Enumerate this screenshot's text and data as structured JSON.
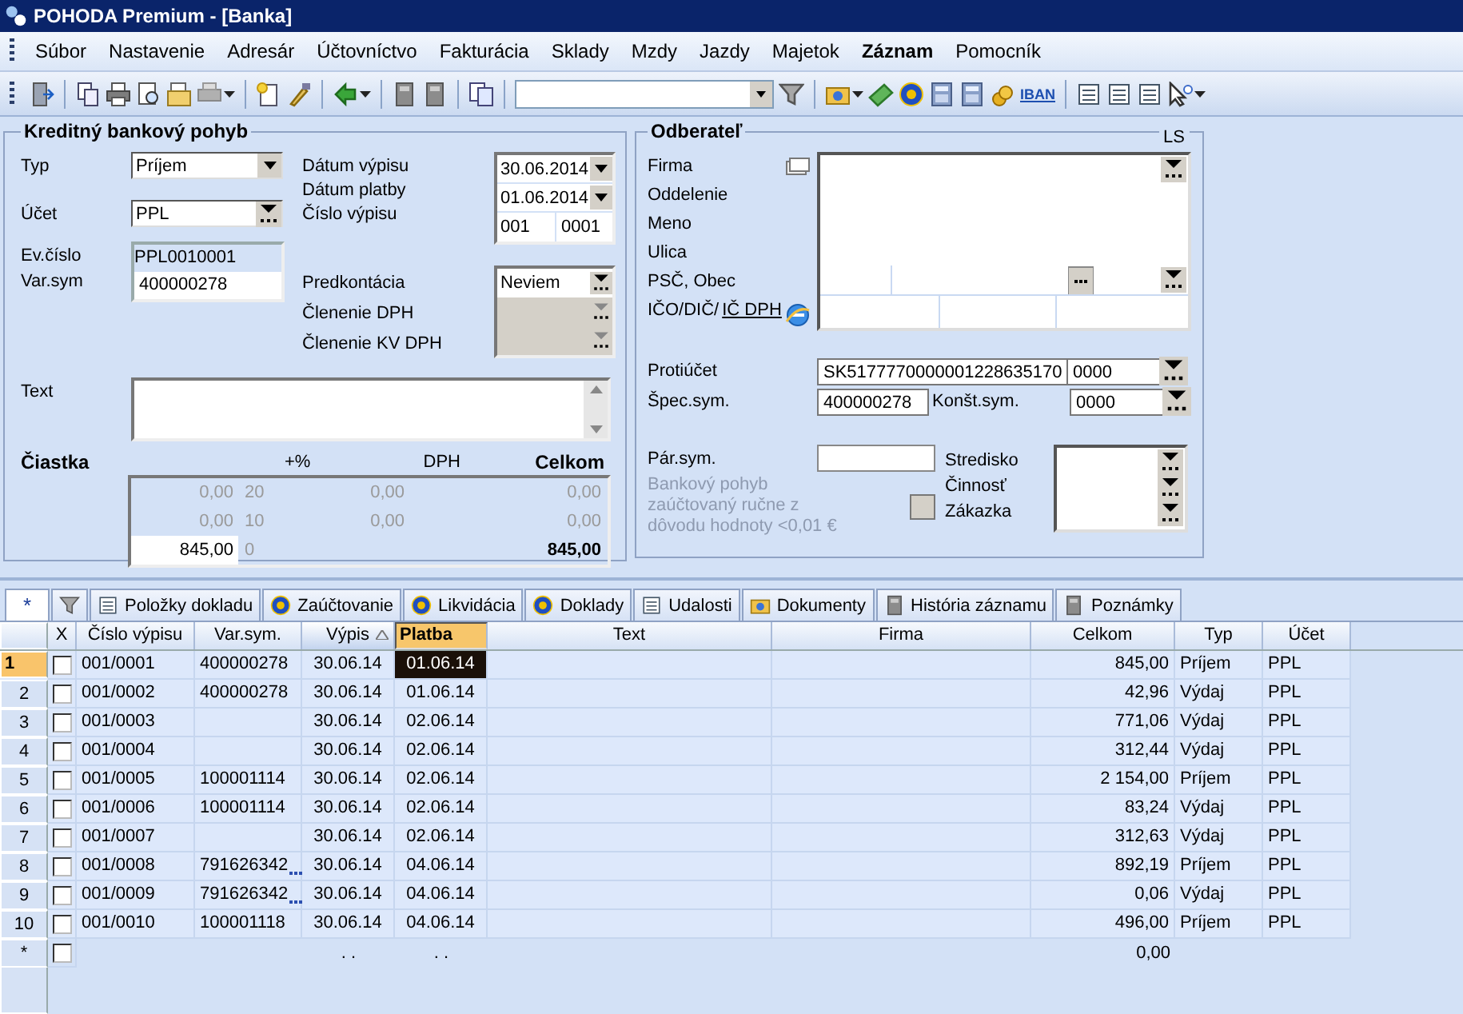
{
  "window": {
    "title": "POHODA Premium - [Banka]"
  },
  "menu": [
    {
      "label": "Súbor",
      "emphasized": false
    },
    {
      "label": "Nastavenie",
      "emphasized": false
    },
    {
      "label": "Adresár",
      "emphasized": false
    },
    {
      "label": "Účtovníctvo",
      "emphasized": false
    },
    {
      "label": "Fakturácia",
      "emphasized": false
    },
    {
      "label": "Sklady",
      "emphasized": false
    },
    {
      "label": "Mzdy",
      "emphasized": false
    },
    {
      "label": "Jazdy",
      "emphasized": false
    },
    {
      "label": "Majetok",
      "emphasized": false
    },
    {
      "label": "Záznam",
      "emphasized": true
    },
    {
      "label": "Pomocník",
      "emphasized": false
    }
  ],
  "toolbar": {
    "iban_label": "IBAN"
  },
  "header_panel": {
    "title": "Kreditný bankový pohyb",
    "typ": {
      "label": "Typ",
      "value": "Príjem"
    },
    "ucet": {
      "label": "Účet",
      "value": "PPL"
    },
    "ev_cislo": {
      "label": "Ev.číslo",
      "value": "PPL0010001"
    },
    "var_sym": {
      "label": "Var.sym",
      "value": "400000278"
    },
    "datum_vypisu": {
      "label": "Dátum výpisu",
      "value": "30.06.2014"
    },
    "datum_platby": {
      "label": "Dátum platby",
      "value": "01.06.2014"
    },
    "cislo_vypisu": {
      "label": "Číslo výpisu",
      "values": [
        "001",
        "0001"
      ]
    },
    "classification": [
      {
        "label": "Predkontácia",
        "value": "Neviem",
        "disabled": false
      },
      {
        "label": "Členenie DPH",
        "disabled": true
      },
      {
        "label": "Členenie KV DPH",
        "disabled": true
      }
    ],
    "text": {
      "label": "Text"
    },
    "amount": {
      "label": "Čiastka",
      "columns": [
        "+%",
        "DPH",
        "Celkom"
      ],
      "rows": [
        {
          "base": "0,00",
          "rate": "20",
          "vat": "0,00",
          "total": "0,00",
          "disabled": true
        },
        {
          "base": "0,00",
          "rate": "10",
          "vat": "0,00",
          "total": "0,00",
          "disabled": true
        },
        {
          "base": "845,00",
          "rate": "0",
          "total": "845,00",
          "disabled": false
        }
      ]
    }
  },
  "partner_panel": {
    "title": "Odberateľ",
    "corner": "LS",
    "labels": [
      "Firma",
      "Oddelenie",
      "Meno",
      "Ulica",
      "PSČ, Obec"
    ],
    "ico_label": "IČO/DIČ/",
    "ic_dph_link": "IČ DPH",
    "protiucet": {
      "label": "Protiúčet",
      "value": "SK5177770000001228635170",
      "bank_code": "0000"
    },
    "spec_sym": {
      "label": "Špec.sym.",
      "value": "400000278"
    },
    "konst_sym": {
      "label": "Konšt.sym.",
      "value": "0000"
    },
    "par_sym": {
      "label": "Pár.sym."
    },
    "manual_note": {
      "text": "Bankový pohyb zaúčtovaný ručne z dôvodu hodnoty <0,01 €",
      "checked": false,
      "disabled": true
    },
    "assignment_labels": [
      "Stredisko",
      "Činnosť",
      "Zákazka"
    ]
  },
  "agenda_tabs": [
    {
      "label": "*",
      "kind": "star",
      "selected": true
    },
    {
      "kind": "filter",
      "selected": false
    },
    {
      "label": "Položky dokladu",
      "kind": "list",
      "selected": false
    },
    {
      "label": "Zaúčtovanie",
      "kind": "coin",
      "selected": false
    },
    {
      "label": "Likvidácia",
      "kind": "coin",
      "selected": false
    },
    {
      "label": "Doklady",
      "kind": "coin",
      "selected": false
    },
    {
      "label": "Udalosti",
      "kind": "list",
      "selected": false
    },
    {
      "label": "Dokumenty",
      "kind": "folder",
      "selected": false
    },
    {
      "label": "História záznamu",
      "kind": "page",
      "selected": false
    },
    {
      "label": "Poznámky",
      "kind": "page",
      "selected": false
    }
  ],
  "table": {
    "columns": [
      {
        "label": "X",
        "sorted": false,
        "selected": false
      },
      {
        "label": "Číslo výpisu",
        "sorted": false,
        "selected": false
      },
      {
        "label": "Var.sym.",
        "sorted": false,
        "selected": false
      },
      {
        "label": "Výpis",
        "sorted": true,
        "selected": false
      },
      {
        "label": "Platba",
        "sorted": false,
        "selected": true
      },
      {
        "label": "Text",
        "sorted": false,
        "selected": false
      },
      {
        "label": "Firma",
        "sorted": false,
        "selected": false
      },
      {
        "label": "Celkom",
        "sorted": false,
        "selected": false
      },
      {
        "label": "Typ",
        "sorted": false,
        "selected": false
      },
      {
        "label": "Účet",
        "sorted": false,
        "selected": false
      }
    ],
    "rows": [
      {
        "number": "1",
        "selected": true,
        "checked": false,
        "cislo": "001/0001",
        "var_sym": "400000278",
        "var_sym_more": false,
        "vypis": "30.06.14",
        "platba": "01.06.14",
        "celkom": "845,00",
        "typ": "Príjem",
        "ucet": "PPL"
      },
      {
        "number": "2",
        "selected": false,
        "checked": false,
        "cislo": "001/0002",
        "var_sym": "400000278",
        "var_sym_more": false,
        "vypis": "30.06.14",
        "platba": "01.06.14",
        "celkom": "42,96",
        "typ": "Výdaj",
        "ucet": "PPL"
      },
      {
        "number": "3",
        "selected": false,
        "checked": false,
        "cislo": "001/0003",
        "var_sym_more": false,
        "vypis": "30.06.14",
        "platba": "02.06.14",
        "celkom": "771,06",
        "typ": "Výdaj",
        "ucet": "PPL"
      },
      {
        "number": "4",
        "selected": false,
        "checked": false,
        "cislo": "001/0004",
        "var_sym_more": false,
        "vypis": "30.06.14",
        "platba": "02.06.14",
        "celkom": "312,44",
        "typ": "Výdaj",
        "ucet": "PPL"
      },
      {
        "number": "5",
        "selected": false,
        "checked": false,
        "cislo": "001/0005",
        "var_sym": "100001114",
        "var_sym_more": false,
        "vypis": "30.06.14",
        "platba": "02.06.14",
        "celkom": "2 154,00",
        "typ": "Príjem",
        "ucet": "PPL"
      },
      {
        "number": "6",
        "selected": false,
        "checked": false,
        "cislo": "001/0006",
        "var_sym": "100001114",
        "var_sym_more": false,
        "vypis": "30.06.14",
        "platba": "02.06.14",
        "celkom": "83,24",
        "typ": "Výdaj",
        "ucet": "PPL"
      },
      {
        "number": "7",
        "selected": false,
        "checked": false,
        "cislo": "001/0007",
        "var_sym_more": false,
        "vypis": "30.06.14",
        "platba": "02.06.14",
        "celkom": "312,63",
        "typ": "Výdaj",
        "ucet": "PPL"
      },
      {
        "number": "8",
        "selected": false,
        "checked": false,
        "cislo": "001/0008",
        "var_sym": "791626342",
        "var_sym_more": true,
        "vypis": "30.06.14",
        "platba": "04.06.14",
        "celkom": "892,19",
        "typ": "Príjem",
        "ucet": "PPL"
      },
      {
        "number": "9",
        "selected": false,
        "checked": false,
        "cislo": "001/0009",
        "var_sym": "791626342",
        "var_sym_more": true,
        "vypis": "30.06.14",
        "platba": "04.06.14",
        "celkom": "0,06",
        "typ": "Výdaj",
        "ucet": "PPL"
      },
      {
        "number": "10",
        "selected": false,
        "checked": false,
        "cislo": "001/0010",
        "var_sym": "100001118",
        "var_sym_more": false,
        "vypis": "30.06.14",
        "platba": "04.06.14",
        "celkom": "496,00",
        "typ": "Príjem",
        "ucet": "PPL"
      }
    ],
    "new_row": {
      "marker": "*",
      "checked": false,
      "vypis": ". .",
      "platba": ". .",
      "celkom": "0,00"
    }
  }
}
